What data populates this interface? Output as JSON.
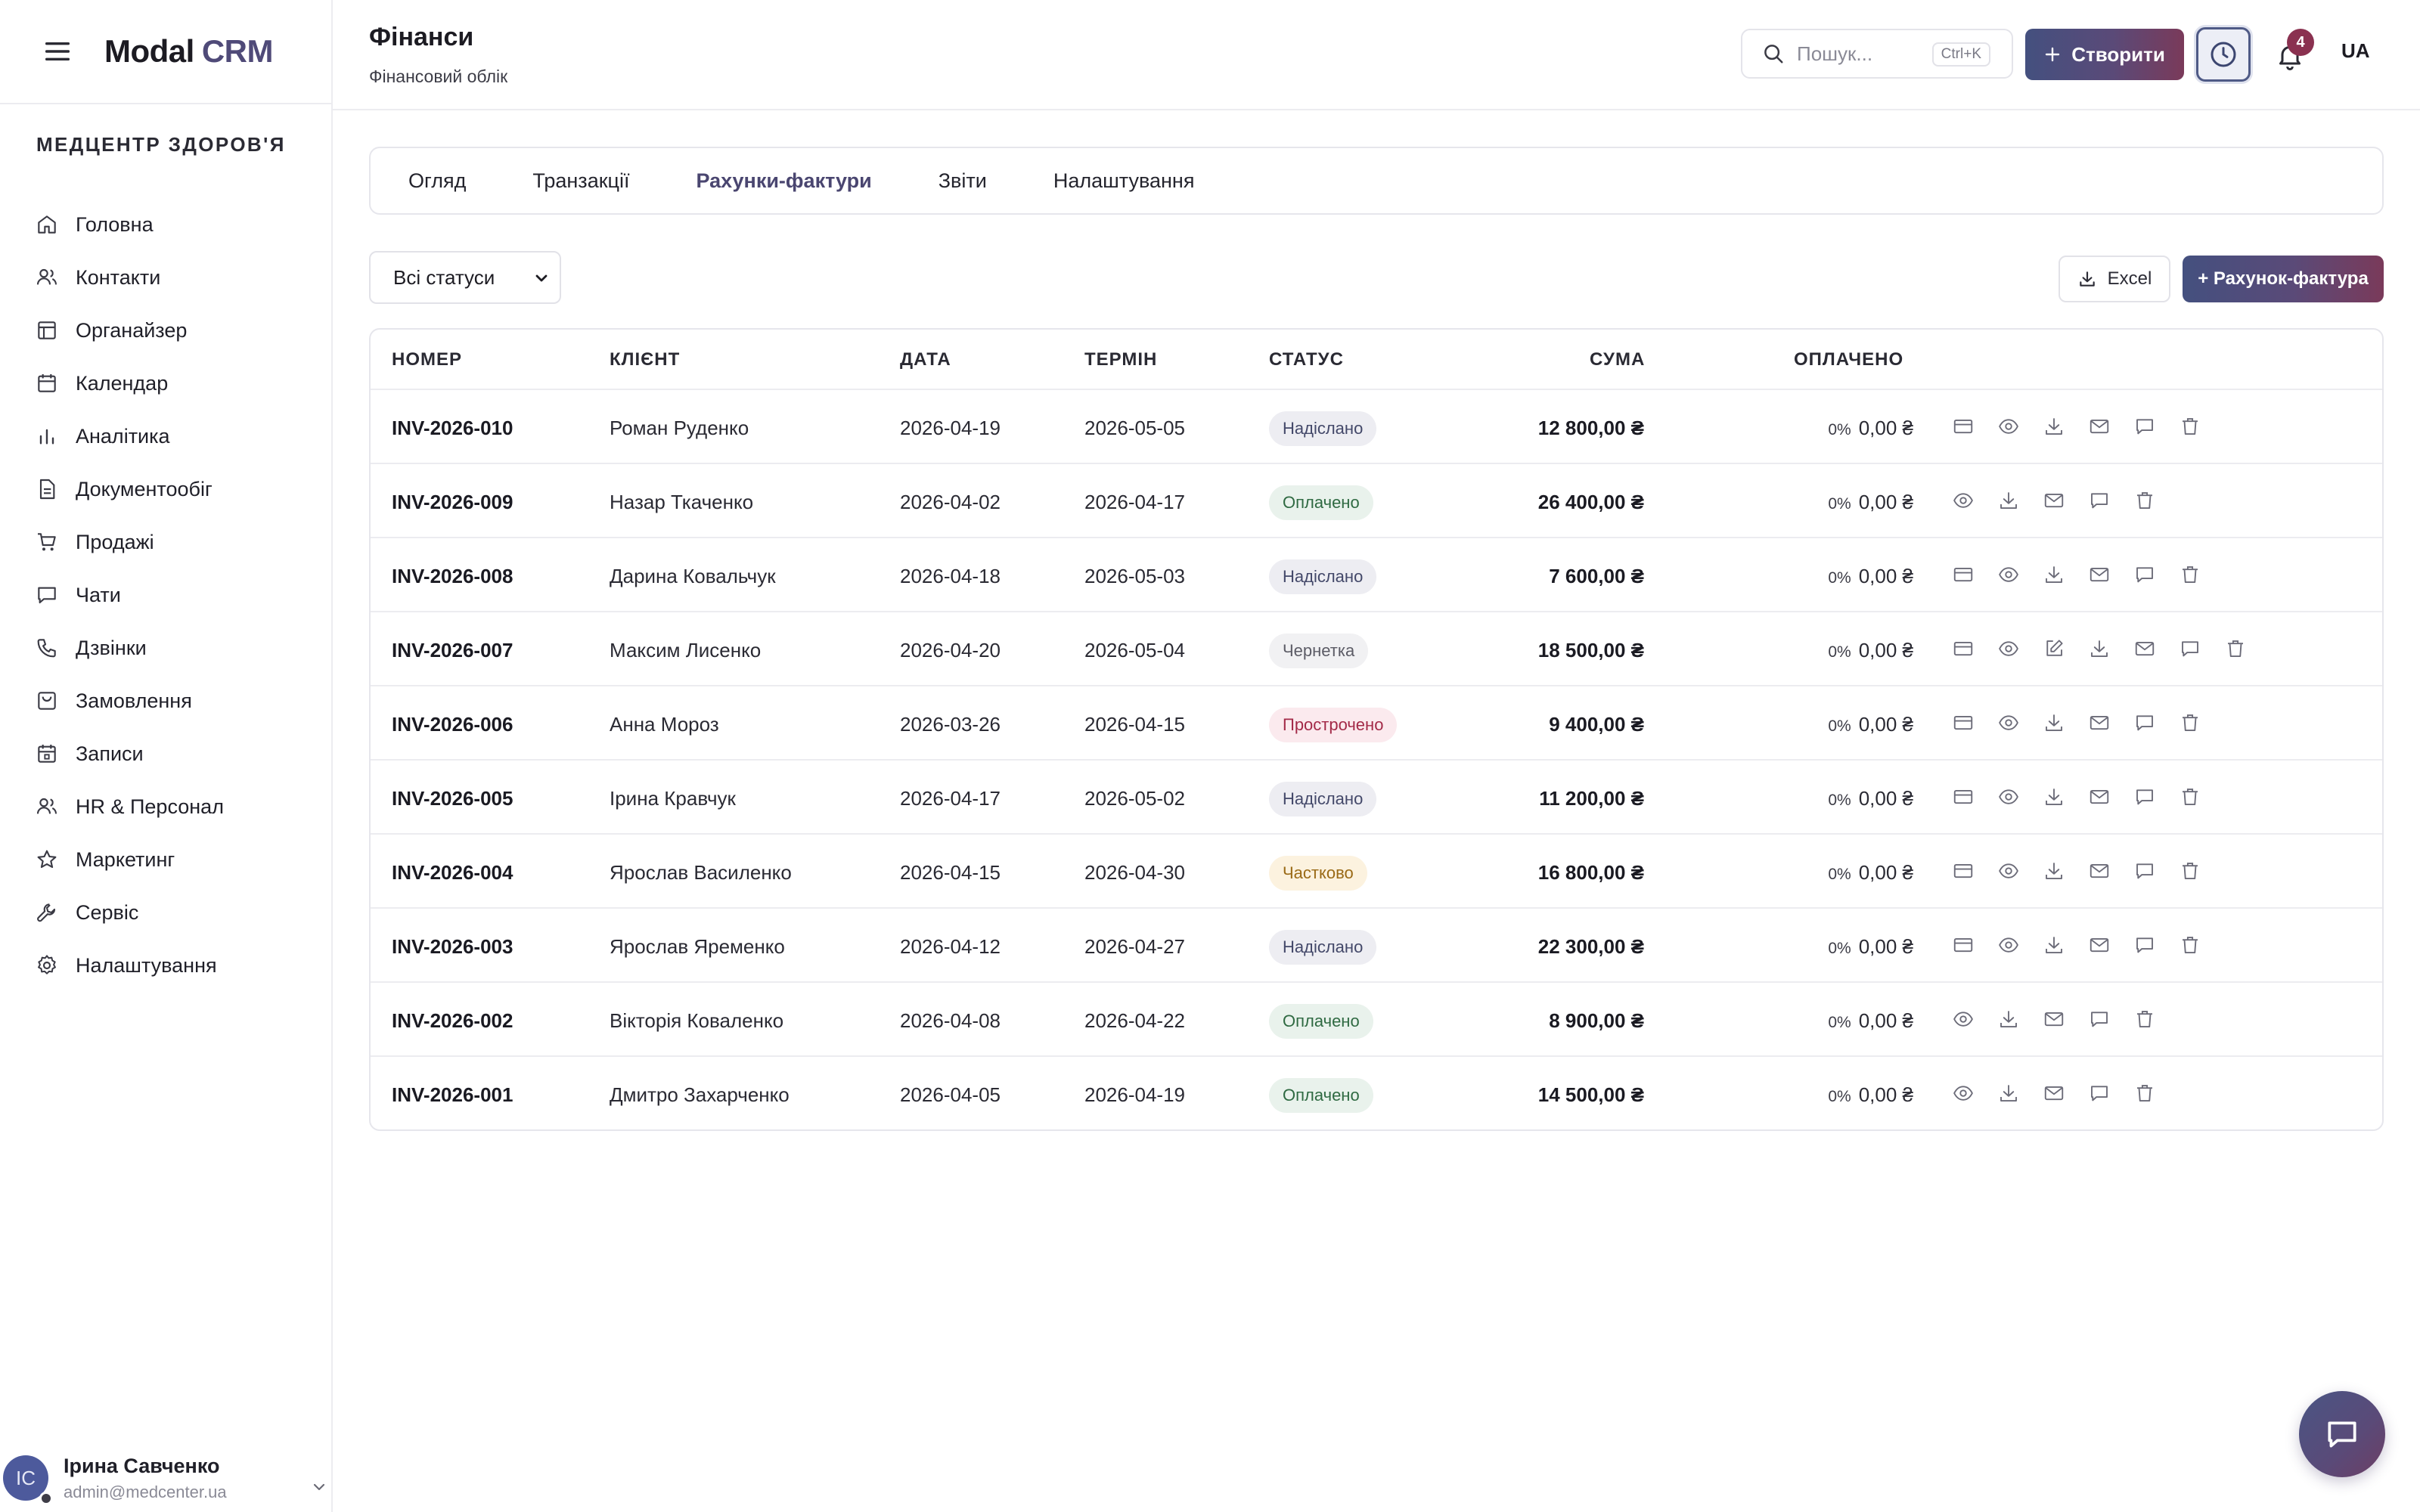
{
  "app": {
    "logo_main": "Modal",
    "logo_accent": "CRM",
    "org_name": "МЕДЦЕНТР ЗДОРОВ'Я"
  },
  "sidebar": {
    "items": [
      {
        "label": "Головна",
        "icon": "home-icon"
      },
      {
        "label": "Контакти",
        "icon": "users-icon"
      },
      {
        "label": "Органайзер",
        "icon": "layout-icon"
      },
      {
        "label": "Календар",
        "icon": "calendar-icon"
      },
      {
        "label": "Аналітика",
        "icon": "bar-chart-icon"
      },
      {
        "label": "Документообіг",
        "icon": "document-icon"
      },
      {
        "label": "Продажі",
        "icon": "cart-icon"
      },
      {
        "label": "Чати",
        "icon": "chat-icon"
      },
      {
        "label": "Дзвінки",
        "icon": "phone-icon"
      },
      {
        "label": "Замовлення",
        "icon": "shopping-bag-icon"
      },
      {
        "label": "Записи",
        "icon": "calendar-check-icon"
      },
      {
        "label": "HR & Персонал",
        "icon": "team-icon"
      },
      {
        "label": "Маркетинг",
        "icon": "star-icon"
      },
      {
        "label": "Сервіс",
        "icon": "wrench-icon"
      },
      {
        "label": "Налаштування",
        "icon": "gear-icon"
      }
    ],
    "user": {
      "initials": "IC",
      "name": "Ірина Савченко",
      "email": "admin@medcenter.ua"
    }
  },
  "header": {
    "title": "Фінанси",
    "subtitle": "Фінансовий облік",
    "search_placeholder": "Пошук...",
    "search_shortcut": "Ctrl+K",
    "create_label": "Створити",
    "notifications_count": "4",
    "language": "UA"
  },
  "tabs": [
    {
      "label": "Огляд",
      "active": false
    },
    {
      "label": "Транзакції",
      "active": false
    },
    {
      "label": "Рахунки-фактури",
      "active": true
    },
    {
      "label": "Звіти",
      "active": false
    },
    {
      "label": "Налаштування",
      "active": false
    }
  ],
  "toolbar": {
    "status_filter": "Всі статуси",
    "excel_label": "Excel",
    "new_invoice_label": "+ Рахунок-фактура"
  },
  "table": {
    "headers": {
      "number": "НОМЕР",
      "client": "КЛІЄНТ",
      "date": "ДАТА",
      "due": "ТЕРМІН",
      "status": "СТАТУС",
      "sum": "СУМА",
      "paid": "ОПЛАЧЕНО"
    },
    "rows": [
      {
        "number": "INV-2026-010",
        "client": "Роман Руденко",
        "date": "2026-04-19",
        "due": "2026-05-05",
        "status": "Надіслано",
        "status_kind": "sent",
        "sum": "12 800,00 ₴",
        "paid_pct": "0%",
        "paid": "0,00 ₴",
        "actions": [
          "card-icon",
          "eye-icon",
          "download-icon",
          "mail-icon",
          "comment-icon",
          "trash-icon"
        ]
      },
      {
        "number": "INV-2026-009",
        "client": "Назар Ткаченко",
        "date": "2026-04-02",
        "due": "2026-04-17",
        "status": "Оплачено",
        "status_kind": "paid",
        "sum": "26 400,00 ₴",
        "paid_pct": "0%",
        "paid": "0,00 ₴",
        "actions": [
          "eye-icon",
          "download-icon",
          "mail-icon",
          "comment-icon",
          "trash-icon"
        ]
      },
      {
        "number": "INV-2026-008",
        "client": "Дарина Ковальчук",
        "date": "2026-04-18",
        "due": "2026-05-03",
        "status": "Надіслано",
        "status_kind": "sent",
        "sum": "7 600,00 ₴",
        "paid_pct": "0%",
        "paid": "0,00 ₴",
        "actions": [
          "card-icon",
          "eye-icon",
          "download-icon",
          "mail-icon",
          "comment-icon",
          "trash-icon"
        ]
      },
      {
        "number": "INV-2026-007",
        "client": "Максим Лисенко",
        "date": "2026-04-20",
        "due": "2026-05-04",
        "status": "Чернетка",
        "status_kind": "draft",
        "sum": "18 500,00 ₴",
        "paid_pct": "0%",
        "paid": "0,00 ₴",
        "actions": [
          "card-icon",
          "eye-icon",
          "edit-icon",
          "download-icon",
          "mail-icon",
          "comment-icon",
          "trash-icon"
        ]
      },
      {
        "number": "INV-2026-006",
        "client": "Анна Мороз",
        "date": "2026-03-26",
        "due": "2026-04-15",
        "status": "Прострочено",
        "status_kind": "overdue",
        "sum": "9 400,00 ₴",
        "paid_pct": "0%",
        "paid": "0,00 ₴",
        "actions": [
          "card-icon",
          "eye-icon",
          "download-icon",
          "mail-icon",
          "comment-icon",
          "trash-icon"
        ]
      },
      {
        "number": "INV-2026-005",
        "client": "Ірина Кравчук",
        "date": "2026-04-17",
        "due": "2026-05-02",
        "status": "Надіслано",
        "status_kind": "sent",
        "sum": "11 200,00 ₴",
        "paid_pct": "0%",
        "paid": "0,00 ₴",
        "actions": [
          "card-icon",
          "eye-icon",
          "download-icon",
          "mail-icon",
          "comment-icon",
          "trash-icon"
        ]
      },
      {
        "number": "INV-2026-004",
        "client": "Ярослав Василенко",
        "date": "2026-04-15",
        "due": "2026-04-30",
        "status": "Частково",
        "status_kind": "partial",
        "sum": "16 800,00 ₴",
        "paid_pct": "0%",
        "paid": "0,00 ₴",
        "actions": [
          "card-icon",
          "eye-icon",
          "download-icon",
          "mail-icon",
          "comment-icon",
          "trash-icon"
        ]
      },
      {
        "number": "INV-2026-003",
        "client": "Ярослав Яременко",
        "date": "2026-04-12",
        "due": "2026-04-27",
        "status": "Надіслано",
        "status_kind": "sent",
        "sum": "22 300,00 ₴",
        "paid_pct": "0%",
        "paid": "0,00 ₴",
        "actions": [
          "card-icon",
          "eye-icon",
          "download-icon",
          "mail-icon",
          "comment-icon",
          "trash-icon"
        ]
      },
      {
        "number": "INV-2026-002",
        "client": "Вікторія Коваленко",
        "date": "2026-04-08",
        "due": "2026-04-22",
        "status": "Оплачено",
        "status_kind": "paid",
        "sum": "8 900,00 ₴",
        "paid_pct": "0%",
        "paid": "0,00 ₴",
        "actions": [
          "eye-icon",
          "download-icon",
          "mail-icon",
          "comment-icon",
          "trash-icon"
        ]
      },
      {
        "number": "INV-2026-001",
        "client": "Дмитро Захарченко",
        "date": "2026-04-05",
        "due": "2026-04-19",
        "status": "Оплачено",
        "status_kind": "paid",
        "sum": "14 500,00 ₴",
        "paid_pct": "0%",
        "paid": "0,00 ₴",
        "actions": [
          "eye-icon",
          "download-icon",
          "mail-icon",
          "comment-icon",
          "trash-icon"
        ]
      }
    ]
  },
  "colors": {
    "accent": "#4f4a78",
    "gradient_start": "#44507f",
    "gradient_end": "#7a3a5a",
    "badge_danger": "#8a3150"
  }
}
